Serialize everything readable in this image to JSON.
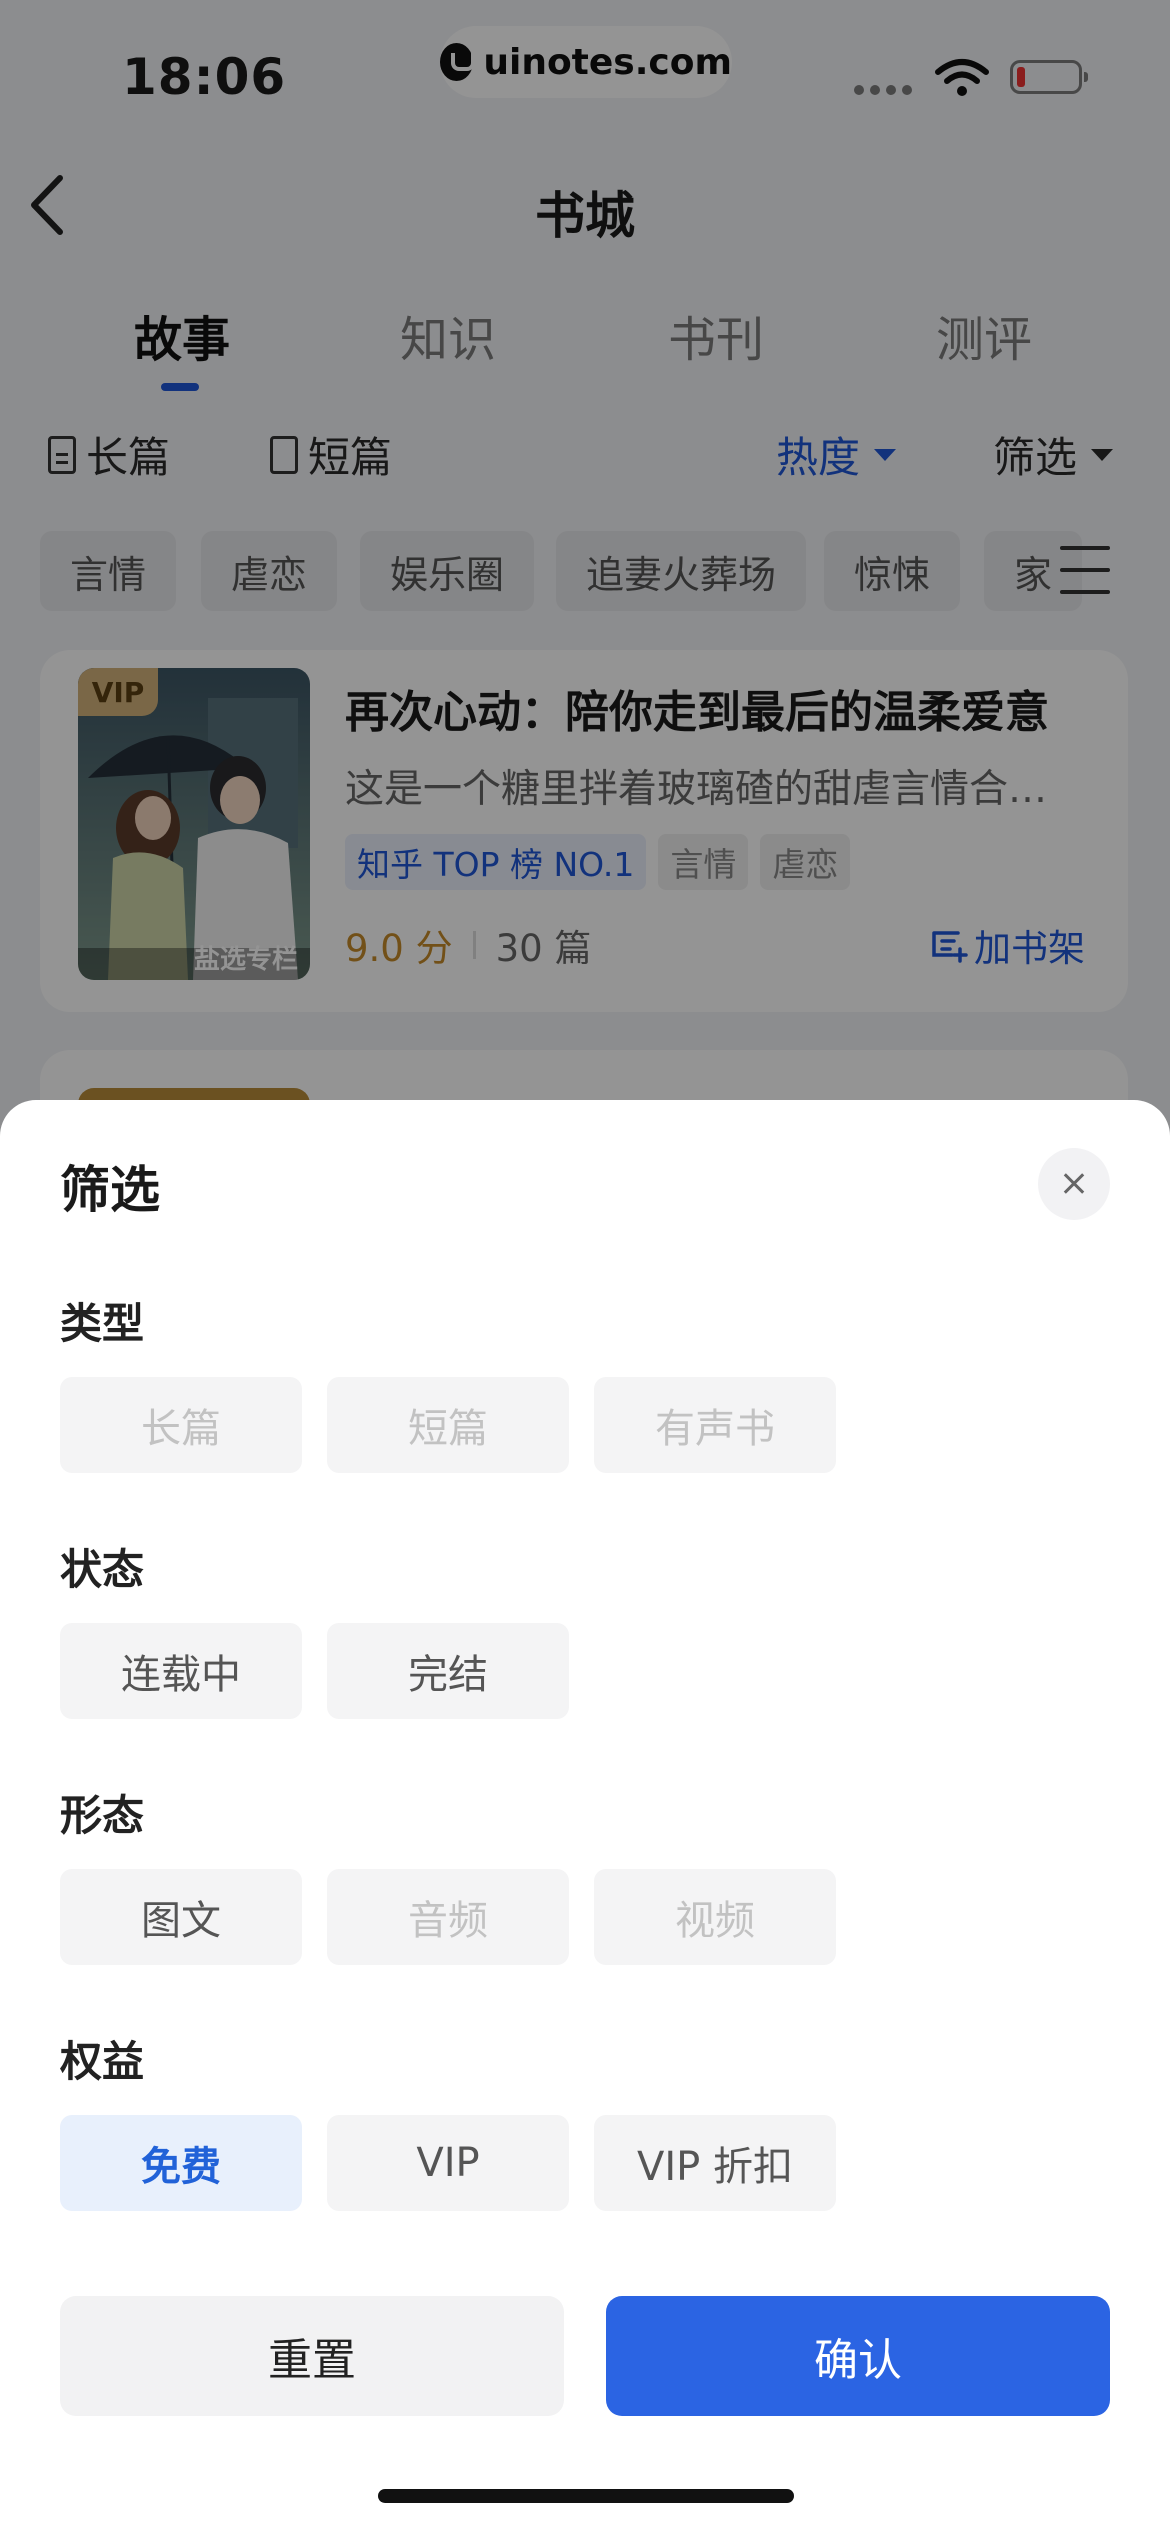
{
  "status_bar": {
    "time": "18:06",
    "watermark": "uinotes.com"
  },
  "header": {
    "title": "书城"
  },
  "tabs": [
    {
      "label": "故事",
      "active": true
    },
    {
      "label": "知识",
      "active": false
    },
    {
      "label": "书刊",
      "active": false
    },
    {
      "label": "测评",
      "active": false
    }
  ],
  "filter_row": {
    "long": "长篇",
    "short": "短篇",
    "sort": "热度",
    "filter": "筛选"
  },
  "chips": [
    "言情",
    "虐恋",
    "娱乐圈",
    "追妻火葬场",
    "惊悚",
    "家"
  ],
  "book": {
    "cover_badge": "VIP",
    "cover_caption": "盐选专栏",
    "title": "再次心动：陪你走到最后的温柔爱意",
    "desc": "这是一个糖里拌着玻璃碴的甜虐言情合…",
    "tags": [
      "知乎 TOP 榜 NO.1",
      "言情",
      "虐恋"
    ],
    "score": "9.0 分",
    "count": "30 篇",
    "add_shelf": "加书架"
  },
  "sheet": {
    "title": "筛选",
    "sections": [
      {
        "label": "类型",
        "options": [
          {
            "text": "长篇",
            "state": "disabled"
          },
          {
            "text": "短篇",
            "state": "disabled"
          },
          {
            "text": "有声书",
            "state": "disabled"
          }
        ]
      },
      {
        "label": "状态",
        "options": [
          {
            "text": "连载中",
            "state": "normal"
          },
          {
            "text": "完结",
            "state": "normal"
          }
        ]
      },
      {
        "label": "形态",
        "options": [
          {
            "text": "图文",
            "state": "normal"
          },
          {
            "text": "音频",
            "state": "disabled"
          },
          {
            "text": "视频",
            "state": "disabled"
          }
        ]
      },
      {
        "label": "权益",
        "options": [
          {
            "text": "免费",
            "state": "selected"
          },
          {
            "text": "VIP",
            "state": "normal"
          },
          {
            "text": "VIP 折扣",
            "state": "normal"
          }
        ]
      }
    ],
    "reset_label": "重置",
    "confirm_label": "确认"
  },
  "colors": {
    "accent": "#2b64e3",
    "selected_bg": "#e8f0fc",
    "score": "#c58b2a"
  }
}
